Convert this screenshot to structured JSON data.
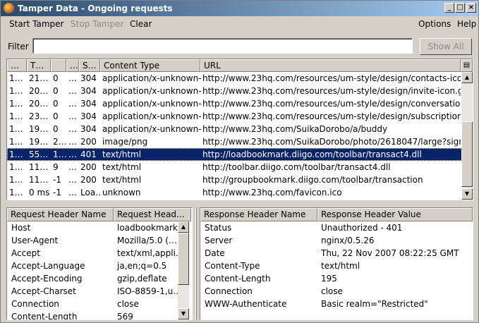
{
  "window": {
    "title": "Tamper Data - Ongoing requests"
  },
  "titlebar_buttons": {
    "minimize": "_",
    "maximize": "□",
    "close": "×"
  },
  "menu": {
    "start": "Start Tamper",
    "stop": "Stop Tamper",
    "clear": "Clear",
    "options": "Options",
    "help": "Help"
  },
  "filter": {
    "label": "Filter",
    "value": "",
    "button": "Show All"
  },
  "requests": {
    "columns": [
      "…",
      "T…",
      "",
      "…",
      "S…",
      "Content Type",
      "URL"
    ],
    "rows": [
      [
        "1…",
        "21…",
        "0",
        "…",
        "304",
        "application/x-unknown-…",
        "http://www.23hq.com/resources/um-style/design/contacts-ico…"
      ],
      [
        "1…",
        "20…",
        "0",
        "…",
        "304",
        "application/x-unknown-…",
        "http://www.23hq.com/resources/um-style/design/invite-icon.gif"
      ],
      [
        "1…",
        "20…",
        "0",
        "…",
        "304",
        "application/x-unknown-…",
        "http://www.23hq.com/resources/um-style/design/conversation…"
      ],
      [
        "1…",
        "23…",
        "0",
        "…",
        "304",
        "application/x-unknown-…",
        "http://www.23hq.com/resources/um-style/design/subscriptions…"
      ],
      [
        "1…",
        "19…",
        "0",
        "…",
        "304",
        "application/x-unknown-…",
        "http://www.23hq.com/SuikaDorobo/a/buddy"
      ],
      [
        "1…",
        "19…",
        "2…",
        "…",
        "200",
        "image/png",
        "http://www.23hq.com/SuikaDorobo/photo/2618047/large?sign…"
      ],
      [
        "1…",
        "55…",
        "1…",
        "…",
        "401",
        "text/html",
        "http://loadbookmark.diigo.com/toolbar/transact4.dll"
      ],
      [
        "1…",
        "11…",
        "9",
        "…",
        "200",
        "text/html",
        "http://toolbar.diigo.com/toolbar/transact4.dll"
      ],
      [
        "1…",
        "11…",
        "-1",
        "…",
        "200",
        "text/html",
        "http://groupbookmark.diigo.com/toolbar/transaction"
      ],
      [
        "1…",
        "0 ms",
        "-1",
        "…",
        "Loa…",
        "unknown",
        "http://www.23hq.com/favicon.ico"
      ]
    ],
    "selected_row_index": 6
  },
  "request_headers": {
    "columns": [
      "Request Header Name",
      "Request Head…"
    ],
    "rows": [
      [
        "Host",
        "loadbookmark…"
      ],
      [
        "User-Agent",
        "Mozilla/5.0 (…"
      ],
      [
        "Accept",
        "text/xml,appli…"
      ],
      [
        "Accept-Language",
        "ja,en;q=0.5"
      ],
      [
        "Accept-Encoding",
        "gzip,deflate"
      ],
      [
        "Accept-Charset",
        "ISO-8859-1,u…"
      ],
      [
        "Connection",
        "close"
      ],
      [
        "Content-Length",
        "569"
      ]
    ]
  },
  "response_headers": {
    "columns": [
      "Response Header Name",
      "Response Header Value"
    ],
    "rows": [
      [
        "Status",
        "Unauthorized - 401"
      ],
      [
        "Server",
        "nginx/0.5.26"
      ],
      [
        "Date",
        "Thu, 22 Nov 2007 08:22:25 GMT"
      ],
      [
        "Content-Type",
        "text/html"
      ],
      [
        "Content-Length",
        "195"
      ],
      [
        "Connection",
        "close"
      ],
      [
        "WWW-Authenticate",
        "Basic realm=\"Restricted\""
      ]
    ]
  },
  "icons": {
    "app": "firefox-icon",
    "column_picker": "column-picker-icon",
    "scroll_up": "▲",
    "scroll_down": "▼"
  },
  "colors": {
    "selection": "#0a246a",
    "title_start": "#2a4a6b",
    "title_end": "#a6caf0"
  }
}
